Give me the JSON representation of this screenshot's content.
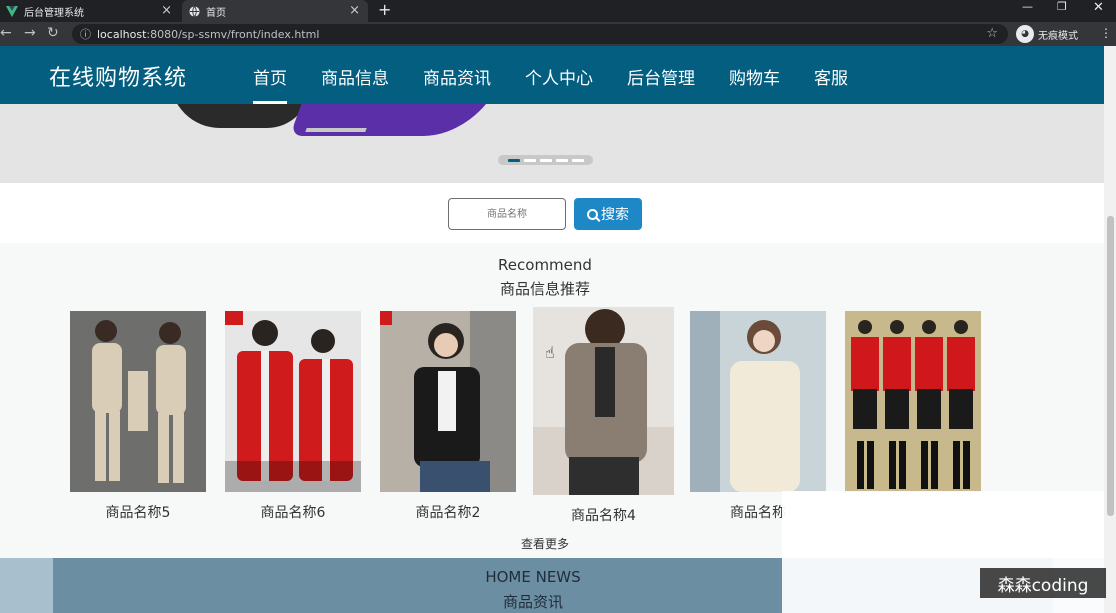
{
  "browser": {
    "tabs": [
      {
        "title": "后台管理系统",
        "icon": "vue-logo-icon"
      },
      {
        "title": "首页",
        "icon": "globe-icon"
      }
    ],
    "url_host": "localhost",
    "url_rest": ":8080/sp-ssmv/front/index.html",
    "profile_label": "无痕模式"
  },
  "header": {
    "logo": "在线购物系统",
    "nav": [
      "首页",
      "商品信息",
      "商品资讯",
      "个人中心",
      "后台管理",
      "购物车",
      "客服"
    ],
    "active_nav_index": 0,
    "accent_color": "#035e80"
  },
  "banner": {
    "slide_count": 5,
    "active_slide": 1
  },
  "search": {
    "placeholder": "商品名称",
    "button_label": "搜索",
    "button_color": "#1e88c7"
  },
  "recommend": {
    "title_en": "Recommend",
    "title_cn": "商品信息推荐",
    "products": [
      {
        "name": "商品名称5"
      },
      {
        "name": "商品名称6"
      },
      {
        "name": "商品名称2"
      },
      {
        "name": "商品名称4"
      },
      {
        "name": "商品名称"
      },
      {
        "name": ""
      }
    ],
    "more_label": "查看更多"
  },
  "news": {
    "title_en": "HOME NEWS",
    "title_cn": "商品资讯"
  },
  "watermark": "森森coding"
}
